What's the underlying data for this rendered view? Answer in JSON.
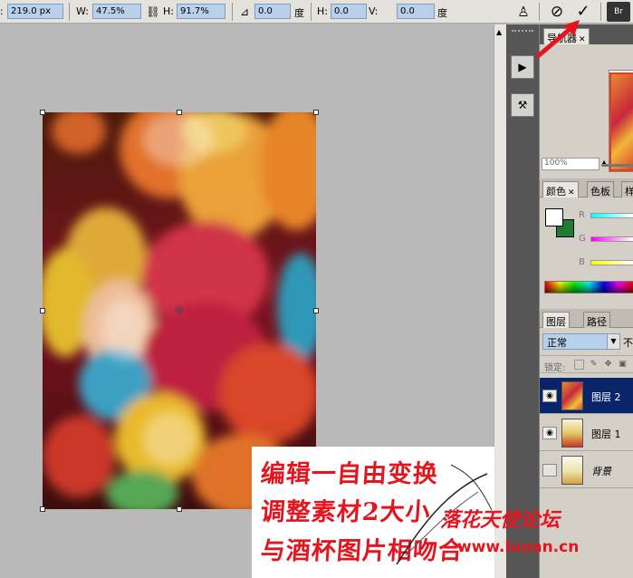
{
  "options_bar": {
    "x_value": "219.0 px",
    "w_label": "W:",
    "w_value": "47.5%",
    "h_label": "H:",
    "h_value": "91.7%",
    "angle_value": "0.0",
    "angle_unit": "度",
    "skew_h_label": "H:",
    "skew_h_value": "0.0",
    "skew_h_unit": "度",
    "skew_v_label": "V:",
    "skew_v_value": "0.0",
    "skew_v_unit": "度"
  },
  "navigator": {
    "tab_label": "导航器",
    "zoom_value": "100%"
  },
  "color_panel": {
    "tabs": [
      "颜色",
      "色板",
      "样"
    ],
    "channels": [
      "R",
      "G",
      "B"
    ]
  },
  "layers_panel": {
    "tabs": [
      "图层",
      "路径"
    ],
    "blend_mode": "正常",
    "opacity_label": "不",
    "lock_label": "锁定:",
    "layers": [
      {
        "name": "图层 2",
        "selected": true
      },
      {
        "name": "图层 1",
        "selected": false
      },
      {
        "name": "背景",
        "selected": false
      }
    ]
  },
  "caption": {
    "line1": "编辑一自由变换",
    "line2": "调整素材2大小",
    "line3": "与酒杯图片相吻合",
    "watermark": "落花天使论坛",
    "watermark_url": "www.luoan.cn"
  },
  "colors": {
    "caption_red": "#e3151f",
    "selection_blue": "#0a246a",
    "dock_gray": "#565656"
  }
}
